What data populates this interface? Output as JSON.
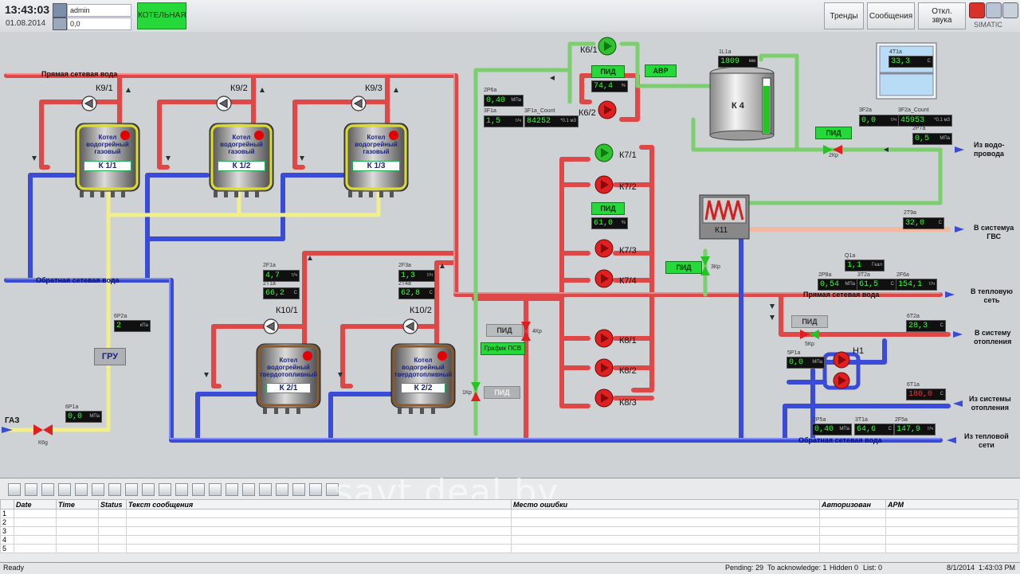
{
  "topbar": {
    "time": "13:43:03",
    "date": "01.08.2014",
    "user": "admin",
    "user_value": "0,0",
    "boiler_room_button": "КОТЕЛЬНАЯ",
    "trends_button": "Тренды",
    "messages_button": "Сообщения",
    "mute_button_line1": "Откл.",
    "mute_button_line2": "звука",
    "brand": "SIMATIC"
  },
  "pipes": {
    "supply_top": "Прямая сетевая вода",
    "return_left": "Обратная сетевая вода",
    "supply_right": "Прямая сетевая вода",
    "return_bottom": "Обратная сетевая вода"
  },
  "boilers": [
    {
      "line1": "Котел",
      "line2": "водогрейный",
      "line3": "газовый",
      "id": "К 1/1"
    },
    {
      "line1": "Котел",
      "line2": "водогрейный",
      "line3": "газовый",
      "id": "К 1/2"
    },
    {
      "line1": "Котел",
      "line2": "водогрейный",
      "line3": "газовый",
      "id": "К 1/3"
    },
    {
      "line1": "Котел",
      "line2": "водогрейный",
      "line3": "твердотопливный",
      "id": "К 2/1"
    },
    {
      "line1": "Котел",
      "line2": "водогрейный",
      "line3": "твердотопливный",
      "id": "К 2/2"
    }
  ],
  "pumps": {
    "k9_1": "К9/1",
    "k9_2": "К9/2",
    "k9_3": "К9/3",
    "k10_1": "К10/1",
    "k10_2": "К10/2",
    "k6_1": "К6/1",
    "k6_2": "К6/2",
    "k7_1": "К7/1",
    "k7_2": "К7/2",
    "k7_3": "К7/3",
    "k7_4": "К7/4",
    "k8_1": "К8/1",
    "k8_2": "К8/2",
    "k8_3": "К8/3",
    "h1": "Н1"
  },
  "valves": {
    "k6g": "К6g",
    "kr1": "1Кр",
    "kr2": "2Кр",
    "kr3": "3Кр",
    "kr4": "4Кр",
    "kr5": "5Кр"
  },
  "equipment": {
    "gru": "ГРУ",
    "k4": "К 4",
    "k11": "К11",
    "gas": "ГАЗ",
    "avr": "АВР",
    "psv_graph": "График ПСВ"
  },
  "pid_buttons": {
    "pid_k6": "ПИД",
    "pid_k7": "ПИД",
    "pid_2kr": "ПИД",
    "pid_3kr": "ПИД",
    "pid_4kr": "ПИД",
    "pid_1kr": "ПИД",
    "pid_5kr": "ПИД"
  },
  "destinations": {
    "from_water_l1": "Из водо-",
    "from_water_l2": "провода",
    "to_gvs_l1": "В системуа",
    "to_gvs_l2": "ГВС",
    "to_heat_net_l1": "В тепловую",
    "to_heat_net_l2": "сеть",
    "to_heating_l1": "В систему",
    "to_heating_l2": "отопления",
    "from_heating_l1": "Из системы",
    "from_heating_l2": "отопления",
    "from_heat_net_l1": "Из тепловой",
    "from_heat_net_l2": "сети"
  },
  "readings": {
    "p6r2a": {
      "tag": "6P2a",
      "value": "2",
      "unit": "кПа"
    },
    "p6r1a": {
      "tag": "6P1a",
      "value": "0,0",
      "unit": "МПа"
    },
    "f2f1a": {
      "tag": "2F1a",
      "value": "4,7",
      "unit": "т/ч"
    },
    "t2t1a": {
      "tag": "2T1a",
      "value": "66,2",
      "unit": "С"
    },
    "f2f3a": {
      "tag": "2F3a",
      "value": "1,3",
      "unit": "т/ч"
    },
    "t2t4a": {
      "tag": "2T4a",
      "value": "62,8",
      "unit": "С"
    },
    "p2p6a": {
      "tag": "2P6a",
      "value": "0,40",
      "unit": "МПа"
    },
    "f3f1a": {
      "tag": "3F1a",
      "value": "1,5",
      "unit": "т/ч"
    },
    "f3f1a_count": {
      "tag": "3F1a_Count",
      "value": "84252",
      "unit": "*0.1 м3"
    },
    "k6_out": {
      "value": "74,4",
      "unit": "%"
    },
    "k7_out": {
      "value": "61,0",
      "unit": "%"
    },
    "l1l1a": {
      "tag": "1L1a",
      "value": "1809",
      "unit": "мм"
    },
    "t4t1a": {
      "tag": "4T1a",
      "value": "33,3",
      "unit": "С"
    },
    "f3f2a": {
      "tag": "3F2a",
      "value": "0,0",
      "unit": "т/ч"
    },
    "f3f2a_count": {
      "tag": "3F2a_Count",
      "value": "45953",
      "unit": "*0.1 м3"
    },
    "p2p7a": {
      "tag": "2P7a",
      "value": "0,5",
      "unit": "МПа"
    },
    "t2t9a": {
      "tag": "2T9a",
      "value": "32,0",
      "unit": "С"
    },
    "q1a": {
      "tag": "Q1a",
      "value": "1,1",
      "unit": "Гкал"
    },
    "p2p8a": {
      "tag": "2P8a",
      "value": "0,54",
      "unit": "МПа"
    },
    "t3t2a": {
      "tag": "3T2a",
      "value": "61,5",
      "unit": "С"
    },
    "f2f6a": {
      "tag": "2F6a",
      "value": "154,1",
      "unit": "т/ч"
    },
    "t6t2a": {
      "tag": "6T2a",
      "value": "28,3",
      "unit": "С"
    },
    "p5p1a": {
      "tag": "5P1a",
      "value": "0,0",
      "unit": "МПа"
    },
    "t6t1a": {
      "tag": "6T1a",
      "value": "180,0",
      "unit": "С"
    },
    "p2p5a": {
      "tag": "2P5a",
      "value": "0,40",
      "unit": "МПа"
    },
    "t3t1a": {
      "tag": "3T1a",
      "value": "64,6",
      "unit": "С"
    },
    "f2f5a": {
      "tag": "2F5a",
      "value": "147,9",
      "unit": "т/ч"
    }
  },
  "alarm_table": {
    "headers": [
      "Date",
      "Time",
      "Status",
      "Текст сообщения",
      "Место ошибки",
      "Авторизован",
      "АРМ"
    ],
    "rows": [
      "1",
      "2",
      "3",
      "4",
      "5"
    ]
  },
  "statusbar": {
    "ready": "Ready",
    "pending": "Pending: 29",
    "to_ack": "To acknowledge: 1",
    "hidden": "Hidden 0",
    "list": "List: 0",
    "date": "8/1/2014",
    "time": "1:43:03 PM"
  },
  "watermark": "savt.deal.by",
  "colors": {
    "hot": "#e04848",
    "cold": "#3a4bd8",
    "feed": "#7ccf6e",
    "gas": "#f2ee8a",
    "active": "#26d93a"
  }
}
